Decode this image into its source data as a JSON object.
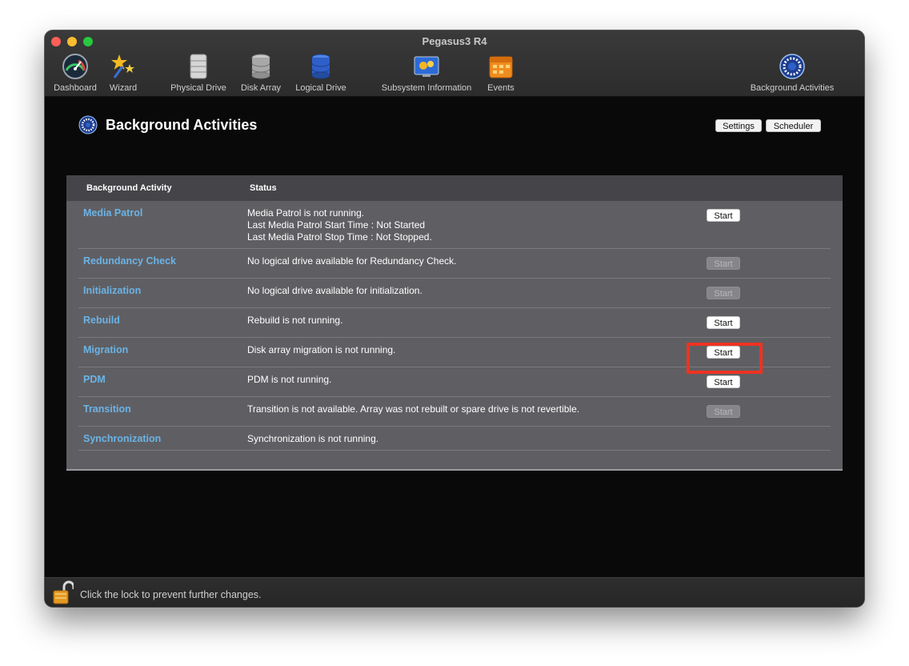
{
  "window": {
    "title": "Pegasus3 R4"
  },
  "toolbar": {
    "items": [
      {
        "label": "Dashboard",
        "icon": "dashboard-gauge-icon"
      },
      {
        "label": "Wizard",
        "icon": "wizard-stars-icon"
      },
      {
        "label": "Physical Drive",
        "icon": "physical-drive-icon"
      },
      {
        "label": "Disk Array",
        "icon": "disk-array-icon"
      },
      {
        "label": "Logical Drive",
        "icon": "logical-drive-icon"
      },
      {
        "label": "Subsystem Information",
        "icon": "subsystem-info-icon"
      },
      {
        "label": "Events",
        "icon": "events-calendar-icon"
      },
      {
        "label": "Background Activities",
        "icon": "background-activities-icon"
      }
    ]
  },
  "page": {
    "title": "Background Activities",
    "settings_label": "Settings",
    "scheduler_label": "Scheduler"
  },
  "table": {
    "headers": {
      "activity": "Background Activity",
      "status": "Status"
    },
    "rows": [
      {
        "name": "Media Patrol",
        "status": [
          "Media Patrol is not running.",
          "Last Media Patrol Start Time : Not Started",
          "Last Media Patrol Stop Time : Not Stopped."
        ],
        "button": "Start",
        "enabled": true
      },
      {
        "name": "Redundancy Check",
        "status": [
          "No logical drive available for Redundancy Check."
        ],
        "button": "Start",
        "enabled": false
      },
      {
        "name": "Initialization",
        "status": [
          "No logical drive available for initialization."
        ],
        "button": "Start",
        "enabled": false
      },
      {
        "name": "Rebuild",
        "status": [
          "Rebuild is not running."
        ],
        "button": "Start",
        "enabled": true,
        "highlighted": true
      },
      {
        "name": "Migration",
        "status": [
          "Disk array migration is not running."
        ],
        "button": "Start",
        "enabled": true
      },
      {
        "name": "PDM",
        "status": [
          "PDM is not running."
        ],
        "button": "Start",
        "enabled": true
      },
      {
        "name": "Transition",
        "status": [
          "Transition is not available. Array was not rebuilt or spare drive is not revertible."
        ],
        "button": "Start",
        "enabled": false
      },
      {
        "name": "Synchronization",
        "status": [
          "Synchronization is not running."
        ]
      }
    ]
  },
  "statusbar": {
    "text": "Click the lock to prevent further changes.",
    "icon": "unlocked-padlock-icon"
  },
  "colors": {
    "link": "#6bb3e6",
    "highlight": "#ee3322",
    "panel": "#5f5f63"
  }
}
